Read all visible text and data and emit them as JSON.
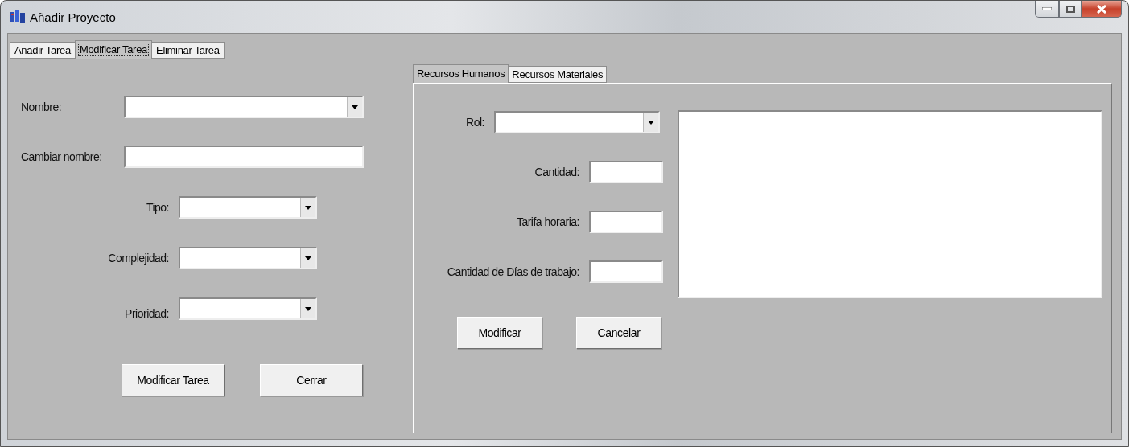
{
  "window": {
    "title": "Añadir Proyecto"
  },
  "tabs": [
    {
      "label": "Añadir Tarea",
      "selected": false
    },
    {
      "label": "Modificar Tarea",
      "selected": true
    },
    {
      "label": "Eliminar Tarea",
      "selected": false
    }
  ],
  "task_form": {
    "fields": [
      {
        "label": "Nombre:",
        "kind": "combo"
      },
      {
        "label": "Cambiar nombre:",
        "kind": "text"
      },
      {
        "label": "Tipo:",
        "kind": "combo"
      },
      {
        "label": "Complejidad:",
        "kind": "combo"
      },
      {
        "label": "Prioridad:",
        "kind": "combo"
      }
    ],
    "buttons": [
      "Modificar Tarea",
      "Cerrar"
    ]
  },
  "resource_tabs": [
    {
      "label": "Recursos Humanos",
      "selected": true
    },
    {
      "label": "Recursos Materiales",
      "selected": false
    }
  ],
  "resource_form": {
    "fields": [
      {
        "label": "Rol:",
        "kind": "combo"
      },
      {
        "label": "Cantidad:",
        "kind": "text"
      },
      {
        "label": "Tarifa horaria:",
        "kind": "text"
      },
      {
        "label": "Cantidad de Días de trabajo:",
        "kind": "text"
      }
    ],
    "buttons": [
      "Modificar",
      "Cancelar"
    ]
  }
}
